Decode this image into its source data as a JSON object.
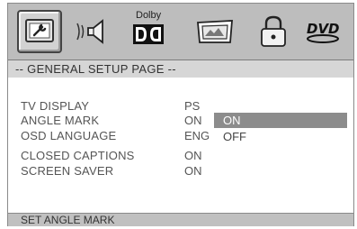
{
  "menu": {
    "tabs": [
      {
        "name": "general-setup",
        "icon": "wrench-monitor-icon",
        "active": true
      },
      {
        "name": "audio-setup",
        "icon": "speaker-icon",
        "active": false
      },
      {
        "name": "dolby-setup",
        "icon": "dolby-icon",
        "label": "Dolby",
        "active": false
      },
      {
        "name": "video-setup",
        "icon": "tv-screen-icon",
        "active": false
      },
      {
        "name": "preference",
        "icon": "lock-icon",
        "active": false
      },
      {
        "name": "dvd",
        "icon": "dvd-logo-icon",
        "active": false
      }
    ],
    "page_title": "-- GENERAL  SETUP  PAGE --",
    "items": [
      {
        "label": "TV DISPLAY",
        "value": "PS"
      },
      {
        "label": "ANGLE MARK",
        "value": "ON",
        "selected": true
      },
      {
        "label": "OSD LANGUAGE",
        "value": "ENG"
      },
      {
        "label": "CLOSED CAPTIONS",
        "value": "ON"
      },
      {
        "label": "SCREEN SAVER",
        "value": "ON"
      }
    ],
    "options": [
      {
        "label": "ON",
        "selected": true
      },
      {
        "label": "OFF",
        "selected": false
      }
    ],
    "status": "SET ANGLE MARK"
  },
  "colors": {
    "frame": "#bdbdbd",
    "highlight": "#8c8c8c",
    "body": "#ffffff"
  }
}
